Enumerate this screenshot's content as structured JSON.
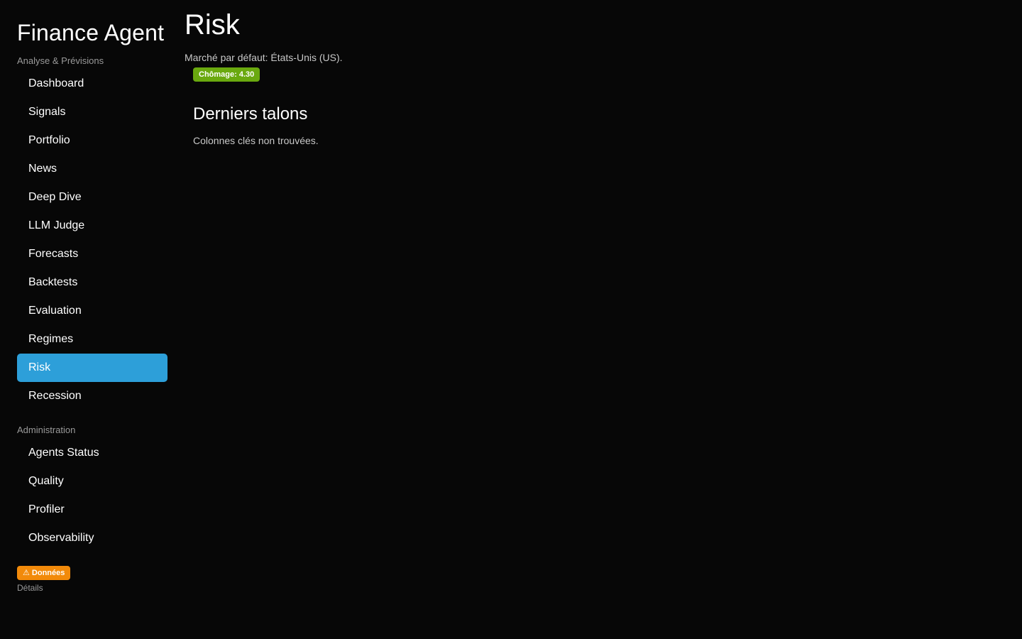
{
  "app": {
    "title": "Finance Agent"
  },
  "sidebar": {
    "sections": [
      {
        "label": "Analyse & Prévisions",
        "items": [
          {
            "label": "Dashboard"
          },
          {
            "label": "Signals"
          },
          {
            "label": "Portfolio"
          },
          {
            "label": "News"
          },
          {
            "label": "Deep Dive"
          },
          {
            "label": "LLM Judge"
          },
          {
            "label": "Forecasts"
          },
          {
            "label": "Backtests"
          },
          {
            "label": "Evaluation"
          },
          {
            "label": "Regimes"
          },
          {
            "label": "Risk",
            "active": true
          },
          {
            "label": "Recession"
          }
        ]
      },
      {
        "label": "Administration",
        "items": [
          {
            "label": "Agents Status"
          },
          {
            "label": "Quality"
          },
          {
            "label": "Profiler"
          },
          {
            "label": "Observability"
          }
        ]
      }
    ],
    "data_badge": "⚠ Données",
    "details_link": "Détails"
  },
  "main": {
    "title": "Risk",
    "market_text": "Marché par défaut: États-Unis (US).",
    "indicator_badge": "Chômage: 4.30",
    "section_title": "Derniers talons",
    "empty_text": "Colonnes clés non trouvées."
  },
  "colors": {
    "background": "#070707",
    "active_nav": "#2d9fd9",
    "indicator_badge": "#6aa90f",
    "warning_badge": "#f28a0a",
    "muted_text": "#9a9a9a"
  }
}
